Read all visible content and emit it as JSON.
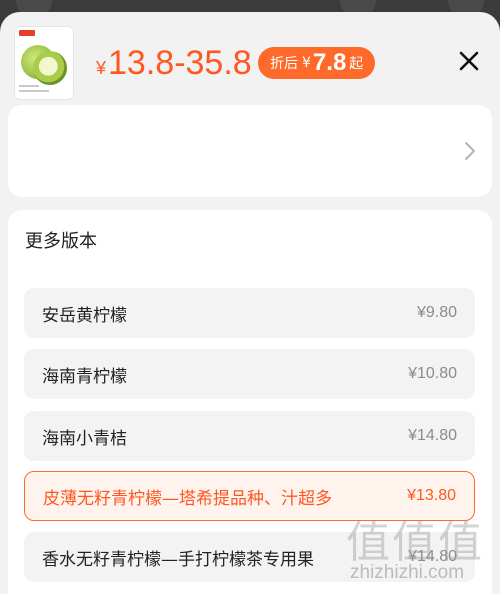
{
  "header": {
    "price_currency": "¥",
    "price_range": "13.8-35.8",
    "discount": {
      "prefix": "折后",
      "currency": "¥",
      "amount": "7.8",
      "suffix": "起"
    }
  },
  "versions": {
    "title": "更多版本",
    "items": [
      {
        "name": "安岳黄柠檬",
        "price": "¥9.80",
        "selected": false
      },
      {
        "name": "海南青柠檬",
        "price": "¥10.80",
        "selected": false
      },
      {
        "name": "海南小青桔",
        "price": "¥14.80",
        "selected": false
      },
      {
        "name": "皮薄无籽青柠檬—塔希提品种、汁超多",
        "price": "¥13.80",
        "selected": true
      },
      {
        "name": "香水无籽青柠檬—手打柠檬茶专用果",
        "price": "¥14.80",
        "selected": false
      }
    ]
  },
  "watermark": {
    "glyphs": "值值值",
    "site": "zhizhizhi.com"
  },
  "colors": {
    "accent": "#ff5722",
    "pill": "#ff6a2a",
    "selected_bg": "#fff3ee"
  }
}
